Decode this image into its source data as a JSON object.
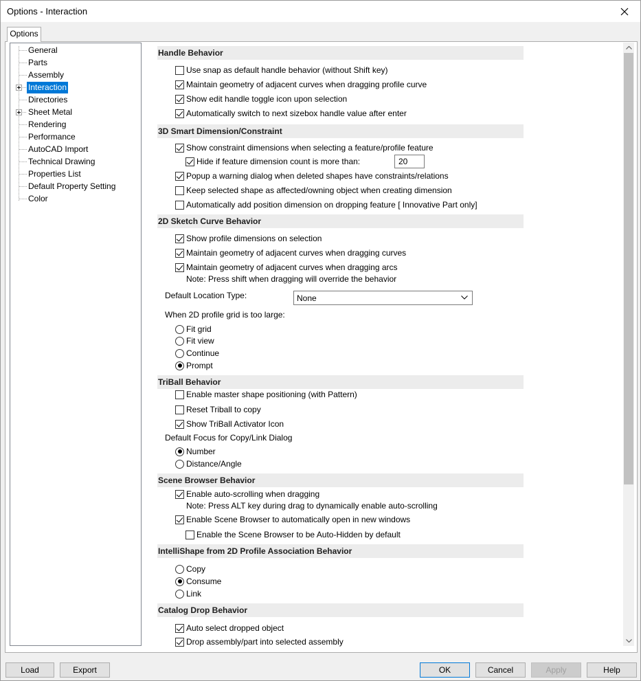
{
  "window": {
    "title": "Options - Interaction"
  },
  "tabs": [
    {
      "label": "Options"
    }
  ],
  "tree": {
    "items": [
      {
        "label": "General",
        "expandable": false
      },
      {
        "label": "Parts",
        "expandable": false
      },
      {
        "label": "Assembly",
        "expandable": false
      },
      {
        "label": "Interaction",
        "expandable": true,
        "selected": true
      },
      {
        "label": "Directories",
        "expandable": false
      },
      {
        "label": "Sheet Metal",
        "expandable": true
      },
      {
        "label": "Rendering",
        "expandable": false
      },
      {
        "label": "Performance",
        "expandable": false
      },
      {
        "label": "AutoCAD Import",
        "expandable": false
      },
      {
        "label": "Technical Drawing",
        "expandable": false
      },
      {
        "label": "Properties List",
        "expandable": false
      },
      {
        "label": "Default Property Setting",
        "expandable": false
      },
      {
        "label": "Color",
        "expandable": false
      }
    ]
  },
  "handle_behavior": {
    "header": "Handle Behavior",
    "options": [
      {
        "label": "Use snap as default handle behavior (without Shift key)",
        "checked": false
      },
      {
        "label": "Maintain geometry of adjacent curves when dragging profile curve",
        "checked": true
      },
      {
        "label": "Show edit handle toggle icon upon selection",
        "checked": true
      },
      {
        "label": "Automatically switch to next sizebox handle value after enter",
        "checked": true
      }
    ]
  },
  "smart_dimension": {
    "header": "3D Smart Dimension/Constraint",
    "options": [
      {
        "label": "Show constraint dimensions when selecting a feature/profile feature",
        "checked": true
      },
      {
        "label": "Hide if feature dimension count is more than:",
        "checked": true
      },
      {
        "label": "Popup a warning dialog when deleted shapes have constraints/relations",
        "checked": true
      },
      {
        "label": "Keep selected shape as affected/owning object when creating dimension",
        "checked": false
      },
      {
        "label": "Automatically add position dimension on dropping feature [ Innovative Part only]",
        "checked": false
      }
    ],
    "hide_count_value": "20"
  },
  "sketch_curve": {
    "header": "2D Sketch Curve Behavior",
    "options": [
      {
        "label": "Show profile dimensions on selection",
        "checked": true
      },
      {
        "label": "Maintain geometry of adjacent curves when dragging curves",
        "checked": true
      },
      {
        "label": "Maintain geometry of adjacent curves when dragging arcs",
        "checked": true
      }
    ],
    "note": "Note: Press shift when dragging will override the behavior",
    "location_label": "Default Location Type:",
    "location_value": "None",
    "grid_label": "When 2D profile grid is too large:",
    "grid_options": [
      {
        "label": "Fit grid",
        "checked": false
      },
      {
        "label": "Fit view",
        "checked": false
      },
      {
        "label": "Continue",
        "checked": false
      },
      {
        "label": "Prompt",
        "checked": true
      }
    ]
  },
  "triball": {
    "header": "TriBall Behavior",
    "options": [
      {
        "label": "Enable master shape positioning (with Pattern)",
        "checked": false
      },
      {
        "label": "Reset Triball to copy",
        "checked": false
      },
      {
        "label": "Show TriBall Activator Icon",
        "checked": true
      }
    ],
    "focus_label": "Default Focus for Copy/Link Dialog",
    "focus_options": [
      {
        "label": "Number",
        "checked": true
      },
      {
        "label": "Distance/Angle",
        "checked": false
      }
    ]
  },
  "scene_browser": {
    "header": "Scene Browser Behavior",
    "auto_scroll": {
      "label": "Enable auto-scrolling when dragging",
      "checked": true
    },
    "note": "Note: Press ALT key during drag to dynamically enable auto-scrolling",
    "auto_open": {
      "label": "Enable Scene Browser to automatically open in new windows",
      "checked": true
    },
    "auto_hide": {
      "label": "Enable the Scene Browser to be Auto-Hidden by default",
      "checked": false
    }
  },
  "intellishape": {
    "header": "IntelliShape from 2D Profile Association Behavior",
    "options": [
      {
        "label": "Copy",
        "checked": false
      },
      {
        "label": "Consume",
        "checked": true
      },
      {
        "label": "Link",
        "checked": false
      }
    ]
  },
  "catalog_drop": {
    "header": "Catalog Drop Behavior",
    "options": [
      {
        "label": "Auto select dropped object",
        "checked": true
      },
      {
        "label": "Drop assembly/part into selected assembly",
        "checked": true
      }
    ]
  },
  "buttons": {
    "load": "Load",
    "export": "Export",
    "ok": "OK",
    "cancel": "Cancel",
    "apply": "Apply",
    "help": "Help"
  }
}
